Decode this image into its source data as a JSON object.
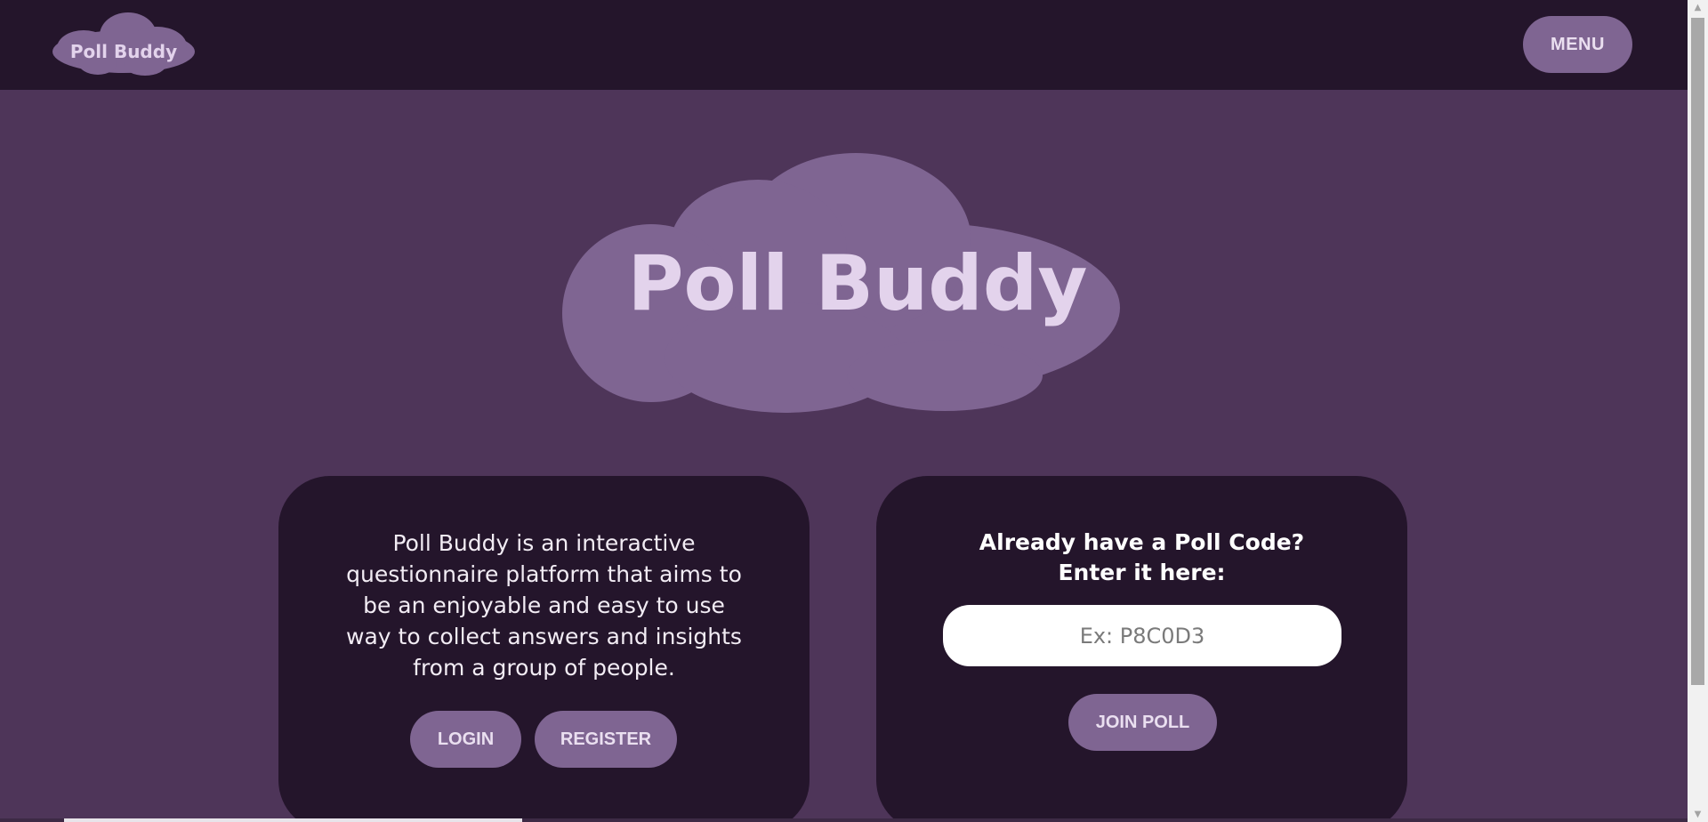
{
  "nav": {
    "logo_text": "Poll Buddy",
    "menu_label": "MENU"
  },
  "hero": {
    "logo_text": "Poll Buddy"
  },
  "about": {
    "description": "Poll Buddy is an interactive questionnaire platform that aims to be an enjoyable and easy to use way to collect answers and insights from a group of people.",
    "login_label": "LOGIN",
    "register_label": "REGISTER"
  },
  "join": {
    "heading": "Already have a Poll Code? Enter it here:",
    "code_placeholder": "Ex: P8C0D3",
    "join_label": "JOIN POLL"
  },
  "colors": {
    "page_background": "#4e3559",
    "header_background": "#24152b",
    "card_background": "#24152b",
    "accent": "#7f6592",
    "logo_text": "#e3d3ec"
  },
  "icons": {
    "scroll_up": "▲",
    "scroll_down": "▼"
  }
}
